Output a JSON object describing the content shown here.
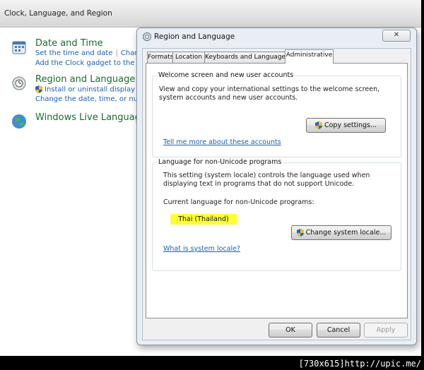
{
  "control_panel": {
    "title": "Clock, Language, and Region",
    "categories": [
      {
        "heading": "Date and Time",
        "links": [
          "Set the time and date",
          "Change",
          "Add the Clock gadget to the desk"
        ]
      },
      {
        "heading": "Region and Language",
        "links": [
          "Install or uninstall display langu",
          "Change the date, time, or numbe"
        ]
      },
      {
        "heading": "Windows Live Language S",
        "links": []
      }
    ]
  },
  "dialog": {
    "title": "Region and Language",
    "close_label": "✕",
    "tabs": [
      "Formats",
      "Location",
      "Keyboards and Languages",
      "Administrative"
    ],
    "active_tab": "Administrative",
    "welcome_group": {
      "title": "Welcome screen and new user accounts",
      "description": "View and copy your international settings to the welcome screen, system accounts and new user accounts.",
      "copy_button": "Copy settings...",
      "link": "Tell me more about these accounts"
    },
    "nonunicode_group": {
      "title": "Language for non-Unicode programs",
      "description": "This setting (system locale) controls the language used when displaying text in programs that do not support Unicode.",
      "current_label": "Current language for non-Unicode programs:",
      "current_value": "Thai (Thailand)",
      "change_button": "Change system locale...",
      "link": "What is system locale?"
    },
    "buttons": {
      "ok": "OK",
      "cancel": "Cancel",
      "apply": "Apply"
    }
  },
  "watermark": "[730x615]http://upic.me/",
  "colors": {
    "highlight": "#ffff33",
    "link": "#1b5fb5",
    "category_heading": "#1a6b2c"
  }
}
